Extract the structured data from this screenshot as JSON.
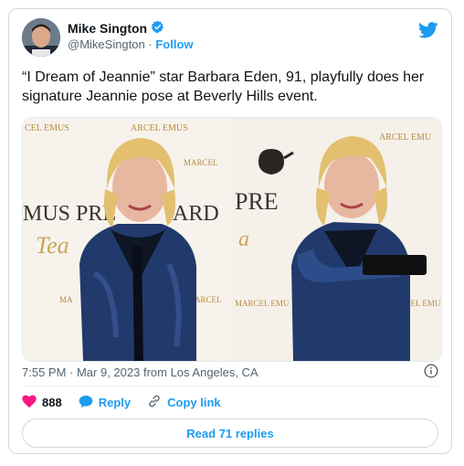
{
  "author": {
    "name": "Mike Sington",
    "handle": "@MikeSington",
    "separator": "·",
    "follow_label": "Follow"
  },
  "tweet": {
    "text": "“I Dream of Jeannie” star Barbara Eden, 91, playfully does her signature Jeannie pose at Beverly Hills event.",
    "timestamp": "7:55 PM · Mar 9, 2023 from Los Angeles, CA"
  },
  "media": {
    "backdrop_left": [
      "CEL EMUS",
      "ARCEL EMUS",
      "MARCEL",
      "MUS PRE",
      "ARD",
      "Tea",
      "MA",
      "ARCEL"
    ],
    "backdrop_right": [
      "ARCEL EMU",
      "PRE",
      "a",
      "MARCEL EMU",
      "ARCEL EMU"
    ]
  },
  "actions": {
    "likes_count": "888",
    "reply_label": "Reply",
    "copy_label": "Copy link",
    "read_replies_label": "Read 71 replies"
  },
  "colors": {
    "accent": "#1d9bf0",
    "like": "#f91880",
    "backdrop": "#f7f3ec",
    "brand_gold": "#b8893f",
    "velvet": "#223a6b"
  },
  "icons": [
    "verified-badge-icon",
    "twitter-bird-icon",
    "info-icon",
    "heart-icon",
    "reply-bubble-icon",
    "link-icon"
  ]
}
